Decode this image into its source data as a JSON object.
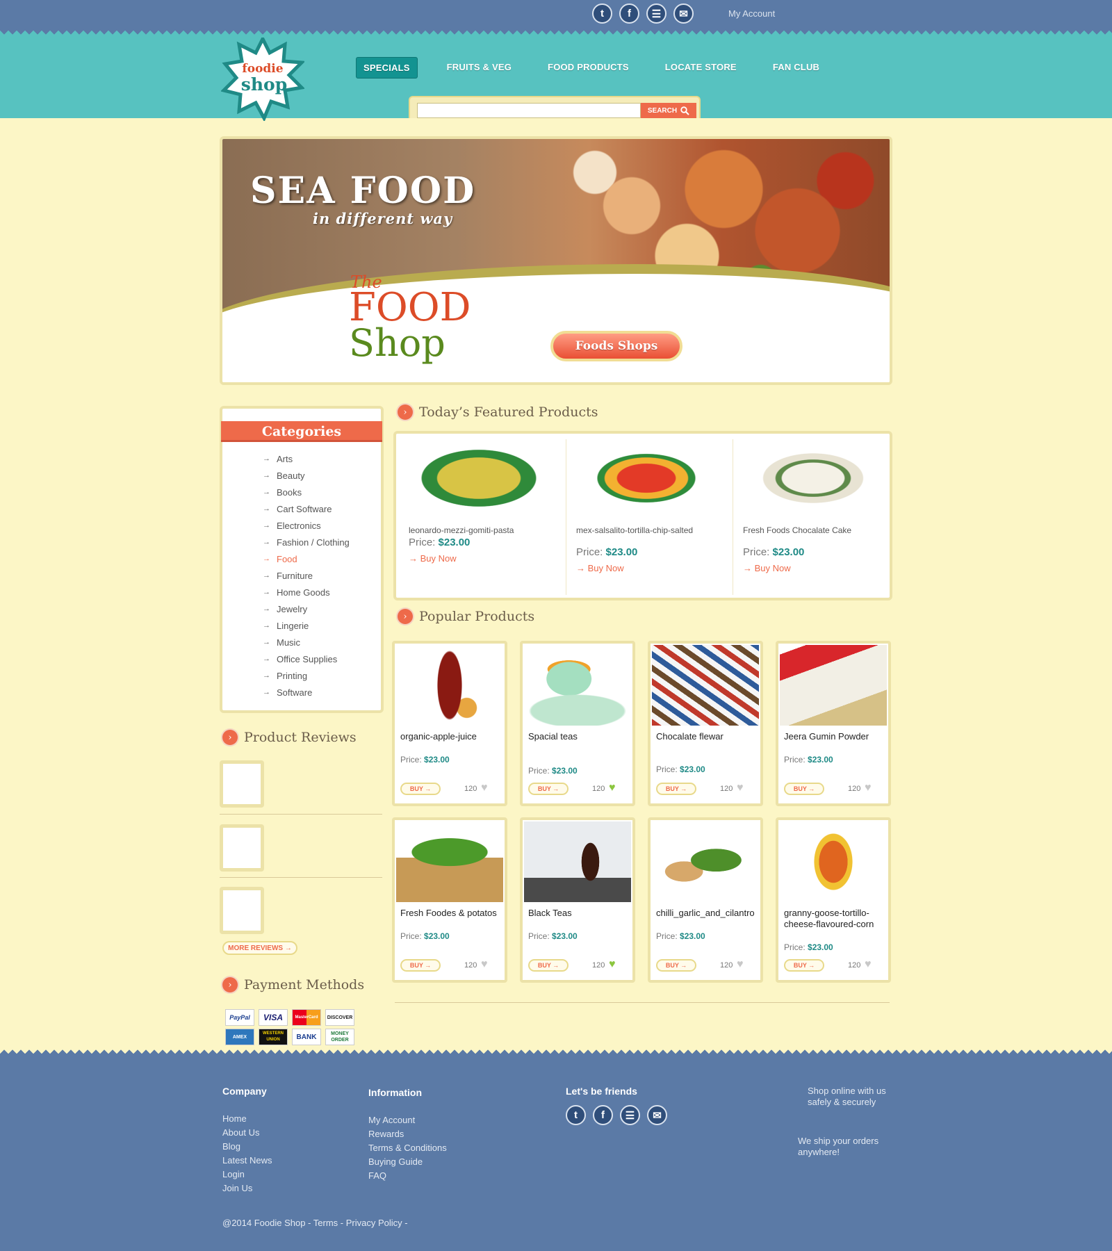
{
  "colors": {
    "accent": "#ee6a4a",
    "teal": "#57c2c0",
    "blue": "#5b7aa6",
    "cream": "#fcf6c6",
    "price": "#1f8a86",
    "liked": "#8cc63f"
  },
  "topbar": {
    "social": [
      {
        "icon": "twitter-icon",
        "glyph": "t"
      },
      {
        "icon": "facebook-icon",
        "glyph": "f"
      },
      {
        "icon": "rss-icon",
        "glyph": "☰"
      },
      {
        "icon": "mail-icon",
        "glyph": "✉"
      }
    ],
    "account": "My Account"
  },
  "logo": {
    "line1": "foodie",
    "line2": "shop"
  },
  "nav": [
    "SPECIALS",
    "FRUITS & VEG",
    "FOOD PRODUCTS",
    "LOCATE STORE",
    "FAN CLUB"
  ],
  "search": {
    "placeholder": "",
    "button": "SEARCH"
  },
  "banner": {
    "title": "SEA FOOD",
    "subtitle": "in different way",
    "the": "The",
    "food": "FOOD",
    "shop": "Shop",
    "cta": "Foods Shops"
  },
  "categories": {
    "title": "Categories",
    "items": [
      "Arts",
      "Beauty",
      "Books",
      "Cart Software",
      "Electronics",
      "Fashion / Clothing",
      "Food",
      "Furniture",
      "Home Goods",
      "Jewelry",
      "Lingerie",
      "Music",
      "Office Supplies",
      "Printing",
      "Software"
    ],
    "active": "Food"
  },
  "reviews": {
    "title": "Product Reviews",
    "more": "MORE REVIEWS →"
  },
  "payments": {
    "title": "Payment Methods",
    "methods": [
      "PayPal",
      "VISA",
      "MasterCard",
      "DISCOVER",
      "AMEX",
      "WESTERN UNION",
      "BANK",
      "MONEY ORDER"
    ]
  },
  "featured": {
    "title": "Today’s Featured Products",
    "price_label": "Price:",
    "buy_label": "Buy Now",
    "items": [
      {
        "name": "leonardo-mezzi-gomiti-pasta",
        "price": "$23.00"
      },
      {
        "name": "mex-salsalito-tortilla-chip-salted",
        "price": "$23.00"
      },
      {
        "name": "Fresh Foods Chocalate Cake",
        "price": "$23.00"
      }
    ]
  },
  "popular": {
    "title": "Popular Products",
    "price_label": "Price:",
    "buy_label": "BUY →",
    "items": [
      {
        "name": "organic-apple-juice",
        "price": "$23.00",
        "likes": "120",
        "liked": false
      },
      {
        "name": "Spacial teas",
        "price": "$23.00",
        "likes": "120",
        "liked": true
      },
      {
        "name": "Chocalate flewar",
        "price": "$23.00",
        "likes": "120",
        "liked": false
      },
      {
        "name": "Jeera Gumin Powder",
        "price": "$23.00",
        "likes": "120",
        "liked": false
      },
      {
        "name": "Fresh Foodes & potatos",
        "price": "$23.00",
        "likes": "120",
        "liked": false
      },
      {
        "name": "Black Teas",
        "price": "$23.00",
        "likes": "120",
        "liked": true
      },
      {
        "name": "chilli_garlic_and_cilantro",
        "price": "$23.00",
        "likes": "120",
        "liked": false
      },
      {
        "name": "granny-goose-tortillo-cheese-flavoured-corn",
        "price": "$23.00",
        "likes": "120",
        "liked": false
      }
    ]
  },
  "footer": {
    "company": {
      "title": "Company",
      "links": [
        "Home",
        "About Us",
        "Blog",
        "Latest News",
        "Login",
        "Join Us"
      ]
    },
    "information": {
      "title": "Information",
      "links": [
        "My Account",
        "Rewards",
        "Terms & Conditions",
        "Buying Guide",
        "FAQ"
      ]
    },
    "friends": {
      "title": "Let's be friends"
    },
    "note1": "Shop online with us safely & securely",
    "note2": "We ship your orders anywhere!",
    "copyright": "@2014 Foodie Shop - Terms - Privacy Policy -"
  }
}
